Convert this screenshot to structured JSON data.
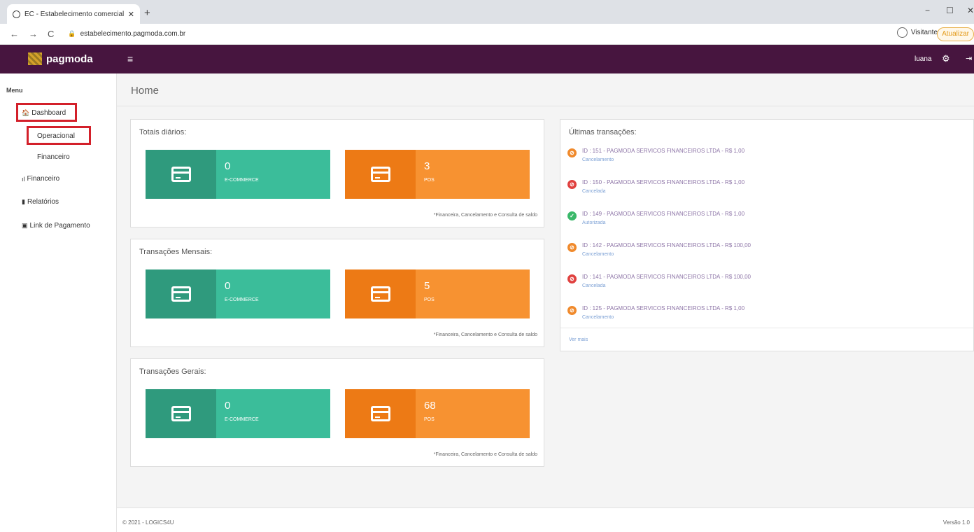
{
  "browser": {
    "tab_title": "EC - Estabelecimento comercial",
    "tab_close": "✕",
    "new_tab": "+",
    "url": "estabelecimento.pagmoda.com.br",
    "profile_label": "Visitante",
    "update_label": "Atualizar",
    "back": "←",
    "forward": "→",
    "reload": "C",
    "minimize": "−",
    "maximize": "☐",
    "close": "✕"
  },
  "header": {
    "logo_text": "pagmoda",
    "menu_icon": "≡",
    "user": "luana",
    "settings_icon": "⚙",
    "logout_icon": "⇥"
  },
  "sidebar": {
    "menu_title": "Menu",
    "items": [
      {
        "label": "Dashboard",
        "icon": "home-icon"
      },
      {
        "label": "Operacional"
      },
      {
        "label": "Financeiro"
      },
      {
        "label": "Financeiro",
        "icon": "chart-icon"
      },
      {
        "label": "Relatórios",
        "icon": "file-icon"
      },
      {
        "label": "Link de Pagamento",
        "icon": "link-icon"
      }
    ]
  },
  "page": {
    "title": "Home"
  },
  "panels": [
    {
      "title": "Totais diários:",
      "ecommerce_value": "0",
      "ecommerce_label": "E-COMMERCE",
      "pos_value": "3",
      "pos_label": "POS",
      "note": "*Financeira, Cancelamento e Consulta de saldo"
    },
    {
      "title": "Transações Mensais:",
      "ecommerce_value": "0",
      "ecommerce_label": "E-COMMERCE",
      "pos_value": "5",
      "pos_label": "POS",
      "note": "*Financeira, Cancelamento e Consulta de saldo"
    },
    {
      "title": "Transações Gerais:",
      "ecommerce_value": "0",
      "ecommerce_label": "E-COMMERCE",
      "pos_value": "68",
      "pos_label": "POS",
      "note": "*Financeira, Cancelamento e Consulta de saldo"
    }
  ],
  "transactions": {
    "title": "Últimas transações:",
    "items": [
      {
        "text": "ID : 151 - PAGMODA SERVICOS FINANCEIROS LTDA - R$ 1,00",
        "status": "Cancelamento",
        "color": "#f08a2c",
        "symbol": "⊘"
      },
      {
        "text": "ID : 150 - PAGMODA SERVICOS FINANCEIROS LTDA - R$ 1,00",
        "status": "Cancelada",
        "color": "#e0413f",
        "symbol": "⊘"
      },
      {
        "text": "ID : 149 - PAGMODA SERVICOS FINANCEIROS LTDA - R$ 1,00",
        "status": "Autorizada",
        "color": "#3ab86a",
        "symbol": "✓"
      },
      {
        "text": "ID : 142 - PAGMODA SERVICOS FINANCEIROS LTDA - R$ 100,00",
        "status": "Cancelamento",
        "color": "#f08a2c",
        "symbol": "⊘"
      },
      {
        "text": "ID : 141 - PAGMODA SERVICOS FINANCEIROS LTDA - R$ 100,00",
        "status": "Cancelada",
        "color": "#e0413f",
        "symbol": "⊘"
      },
      {
        "text": "ID : 125 - PAGMODA SERVICOS FINANCEIROS LTDA - R$ 1,00",
        "status": "Cancelamento",
        "color": "#f08a2c",
        "symbol": "⊘"
      }
    ],
    "more": "Ver mais"
  },
  "footer": {
    "copyright": "© 2021 - LOGICS4U",
    "version": "Versão 1.0"
  }
}
